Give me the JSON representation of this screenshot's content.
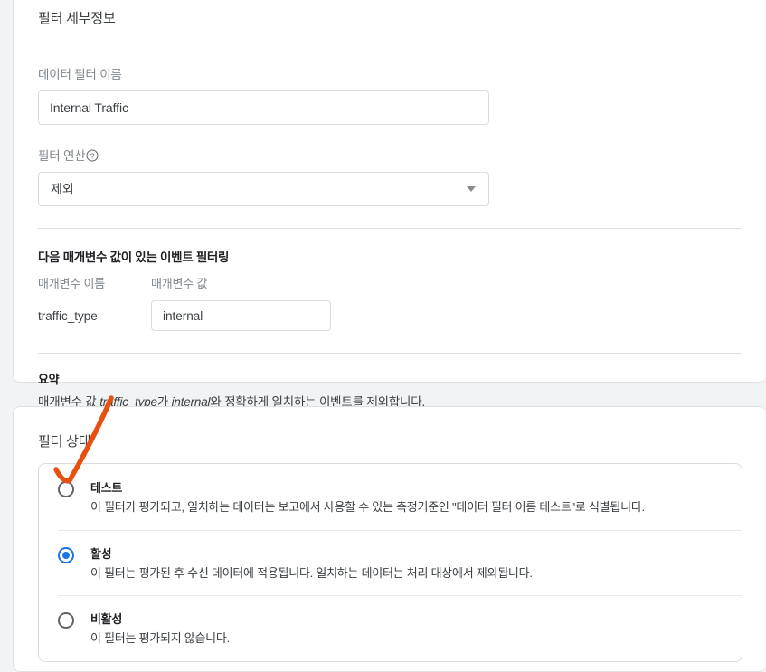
{
  "filter_details": {
    "title": "필터 세부정보",
    "name_label": "데이터 필터 이름",
    "name_value": "Internal Traffic",
    "operation_label": "필터 연산",
    "help_icon": "help-circle-icon",
    "operation_value": "제외",
    "caret_icon": "chevron-down-icon",
    "event_filtering_heading": "다음 매개변수 값이 있는 이벤트 필터링",
    "param_name_column": "매개변수 이름",
    "param_value_column": "매개변수 값",
    "param_key": "traffic_type",
    "param_value": "internal",
    "summary_heading": "요약",
    "summary_prefix": "매개변수 값 ",
    "summary_param": "traffic_type",
    "summary_mid1": "가 ",
    "summary_value": "internal",
    "summary_suffix": "와 정확하게 일치하는 이벤트를 제외합니다."
  },
  "filter_state": {
    "title": "필터 상태",
    "options": [
      {
        "label": "테스트",
        "description": "이 필터가 평가되고, 일치하는 데이터는 보고에서 사용할 수 있는 측정기준인 \"데이터 필터 이름 테스트\"로 식별됩니다.",
        "selected": false
      },
      {
        "label": "활성",
        "description": "이 필터는 평가된 후 수신 데이터에 적용됩니다. 일치하는 데이터는 처리 대상에서 제외됩니다.",
        "selected": true
      },
      {
        "label": "비활성",
        "description": "이 필터는 평가되지 않습니다.",
        "selected": false
      }
    ]
  },
  "annotation": {
    "arrow_color": "#e8500f",
    "arrow_name": "orange-pointer-arrow"
  },
  "colors": {
    "accent": "#1a73e8",
    "page_background": "#f1f3f4",
    "card_background": "#ffffff",
    "border": "#dadce0",
    "text_primary": "#202124",
    "text_secondary": "#80868b",
    "annotation": "#e8500f"
  }
}
